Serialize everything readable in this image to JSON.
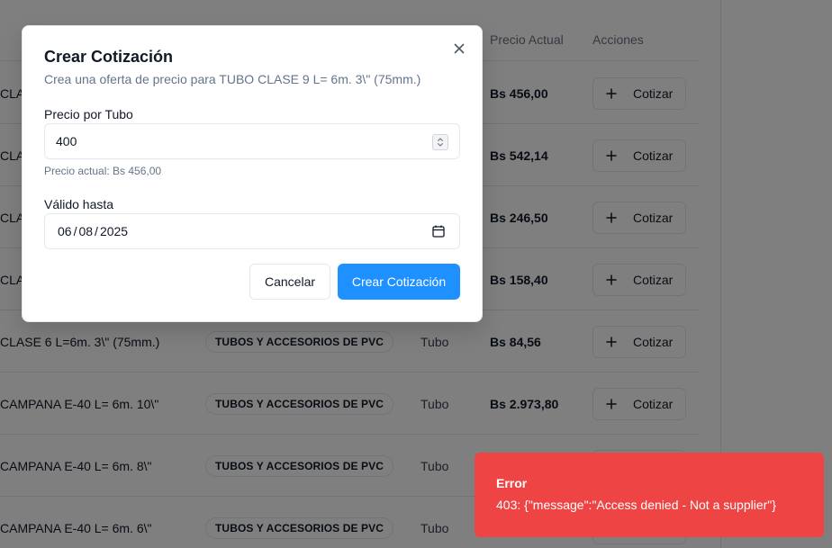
{
  "table": {
    "headers": {
      "price": "Precio Actual",
      "actions": "Acciones"
    },
    "action_label": "Cotizar",
    "rows": [
      {
        "name": "CLASE",
        "category": "",
        "unit": "",
        "price": "Bs 456,00"
      },
      {
        "name": "CLASE",
        "category": "",
        "unit": "",
        "price": "Bs 542,14"
      },
      {
        "name": "CLASE",
        "category": "",
        "unit": "",
        "price": "Bs 246,50"
      },
      {
        "name": "CLASE",
        "category": "",
        "unit": "",
        "price": "Bs 158,40"
      },
      {
        "name": "CLASE 6 L=6m. 3\\\" (75mm.)",
        "category": "TUBOS Y ACCESORIOS DE PVC",
        "unit": "Tubo",
        "price": "Bs 84,56"
      },
      {
        "name": "CAMPANA E-40 L= 6m. 10\\\"",
        "category": "TUBOS Y ACCESORIOS DE PVC",
        "unit": "Tubo",
        "price": "Bs 2.973,80"
      },
      {
        "name": "CAMPANA E-40 L= 6m. 8\\\"",
        "category": "TUBOS Y ACCESORIOS DE PVC",
        "unit": "Tubo",
        "price": ""
      },
      {
        "name": "CAMPANA E-40 L= 6m. 6\\\"",
        "category": "TUBOS Y ACCESORIOS DE PVC",
        "unit": "Tubo",
        "price": ""
      }
    ]
  },
  "modal": {
    "title": "Crear Cotización",
    "description": "Crea una oferta de precio para TUBO CLASE 9 L= 6m. 3\\\" (75mm.)",
    "price_label": "Precio por Tubo",
    "price_value": "400",
    "price_hint": "Precio actual: Bs 456,00",
    "valid_label": "Válido hasta",
    "date": {
      "day": "06",
      "month": "08",
      "year": "2025",
      "sep": "/"
    },
    "cancel_label": "Cancelar",
    "create_label": "Crear Cotización"
  },
  "toast": {
    "title": "Error",
    "message": "403: {\"message\":\"Access denied - Not a supplier\"}"
  },
  "colors": {
    "primary": "#1e90ff",
    "error": "#ef4444",
    "overlay": "rgba(0,0,0,0.5)"
  }
}
